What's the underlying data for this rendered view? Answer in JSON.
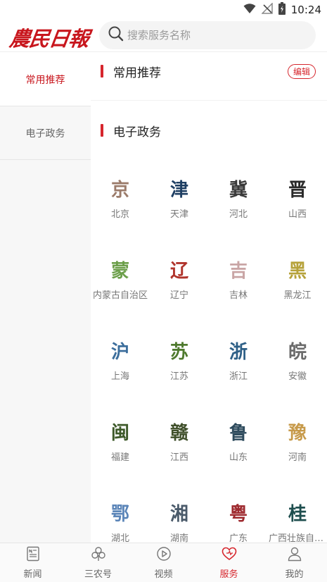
{
  "status": {
    "time": "10:24",
    "icons": [
      "wifi-icon",
      "no-signal-icon",
      "battery-icon"
    ]
  },
  "header": {
    "logo_text": "農民日報",
    "search_placeholder": "搜索服务名称"
  },
  "sidebar": {
    "items": [
      {
        "label": "常用推荐",
        "active": true
      },
      {
        "label": "电子政务",
        "active": false
      }
    ]
  },
  "sections": {
    "recommended": {
      "title": "常用推荐",
      "edit_label": "编辑"
    },
    "egov": {
      "title": "电子政务"
    }
  },
  "provinces": [
    {
      "abbr": "京",
      "name": "北京",
      "color": "#9b7b6a"
    },
    {
      "abbr": "津",
      "name": "天津",
      "color": "#1f3f63"
    },
    {
      "abbr": "冀",
      "name": "河北",
      "color": "#3a3a3a"
    },
    {
      "abbr": "晋",
      "name": "山西",
      "color": "#2a2a2a"
    },
    {
      "abbr": "蒙",
      "name": "内蒙古自治区",
      "color": "#6c9f4a"
    },
    {
      "abbr": "辽",
      "name": "辽宁",
      "color": "#b0342c"
    },
    {
      "abbr": "吉",
      "name": "吉林",
      "color": "#c9a5a5"
    },
    {
      "abbr": "黑",
      "name": "黑龙江",
      "color": "#b6a23a"
    },
    {
      "abbr": "沪",
      "name": "上海",
      "color": "#3c6e9c"
    },
    {
      "abbr": "苏",
      "name": "江苏",
      "color": "#4f7a2e"
    },
    {
      "abbr": "浙",
      "name": "浙江",
      "color": "#2d5f86"
    },
    {
      "abbr": "皖",
      "name": "安徽",
      "color": "#6b6b6b"
    },
    {
      "abbr": "闽",
      "name": "福建",
      "color": "#3e5a2a"
    },
    {
      "abbr": "赣",
      "name": "江西",
      "color": "#3f4f2a"
    },
    {
      "abbr": "鲁",
      "name": "山东",
      "color": "#2d4a5c"
    },
    {
      "abbr": "豫",
      "name": "河南",
      "color": "#c79a4a"
    },
    {
      "abbr": "鄂",
      "name": "湖北",
      "color": "#5b85b8"
    },
    {
      "abbr": "湘",
      "name": "湖南",
      "color": "#4a5a6a"
    },
    {
      "abbr": "粤",
      "name": "广东",
      "color": "#9e2a2f"
    },
    {
      "abbr": "桂",
      "name": "广西壮族自治区",
      "color": "#1e4e4e"
    }
  ],
  "bottom_nav": [
    {
      "label": "新闻",
      "icon": "news-icon",
      "active": false
    },
    {
      "label": "三农号",
      "icon": "clover-icon",
      "active": false
    },
    {
      "label": "视频",
      "icon": "play-icon",
      "active": false
    },
    {
      "label": "服务",
      "icon": "heart-icon",
      "active": true
    },
    {
      "label": "我的",
      "icon": "person-icon",
      "active": false
    }
  ],
  "colors": {
    "accent": "#d6262d",
    "sidebar_bg": "#f7f7f7"
  }
}
